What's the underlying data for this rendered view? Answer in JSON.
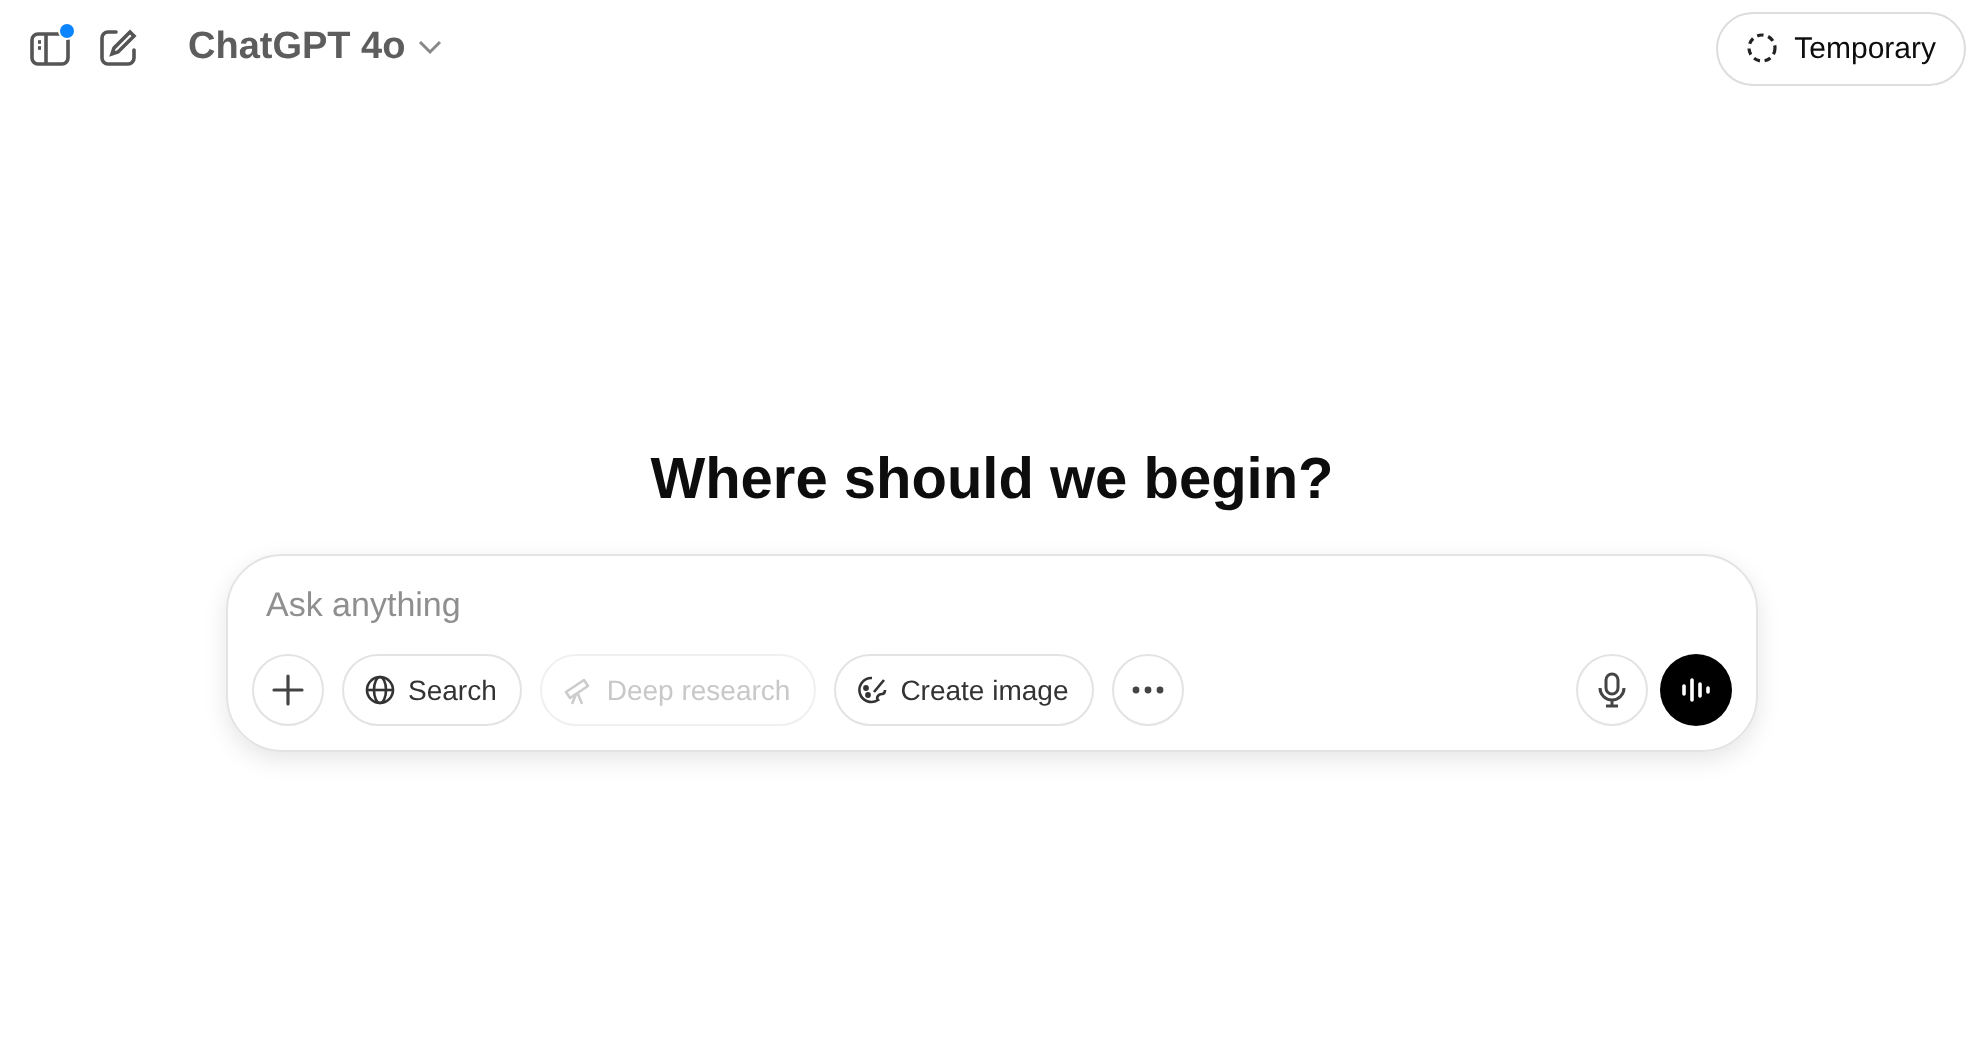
{
  "header": {
    "sidebar_notification": true,
    "model": "ChatGPT 4o",
    "temporary_button": "Temporary"
  },
  "heading": "Where should we begin?",
  "composer": {
    "placeholder": "Ask anything",
    "tools": [
      {
        "kind": "add",
        "disabled": false
      },
      {
        "kind": "search",
        "label": "Search",
        "disabled": false
      },
      {
        "kind": "research",
        "label": "Deep research",
        "disabled": true
      },
      {
        "kind": "image",
        "label": "Create image",
        "disabled": false
      },
      {
        "kind": "more",
        "disabled": false
      }
    ]
  }
}
